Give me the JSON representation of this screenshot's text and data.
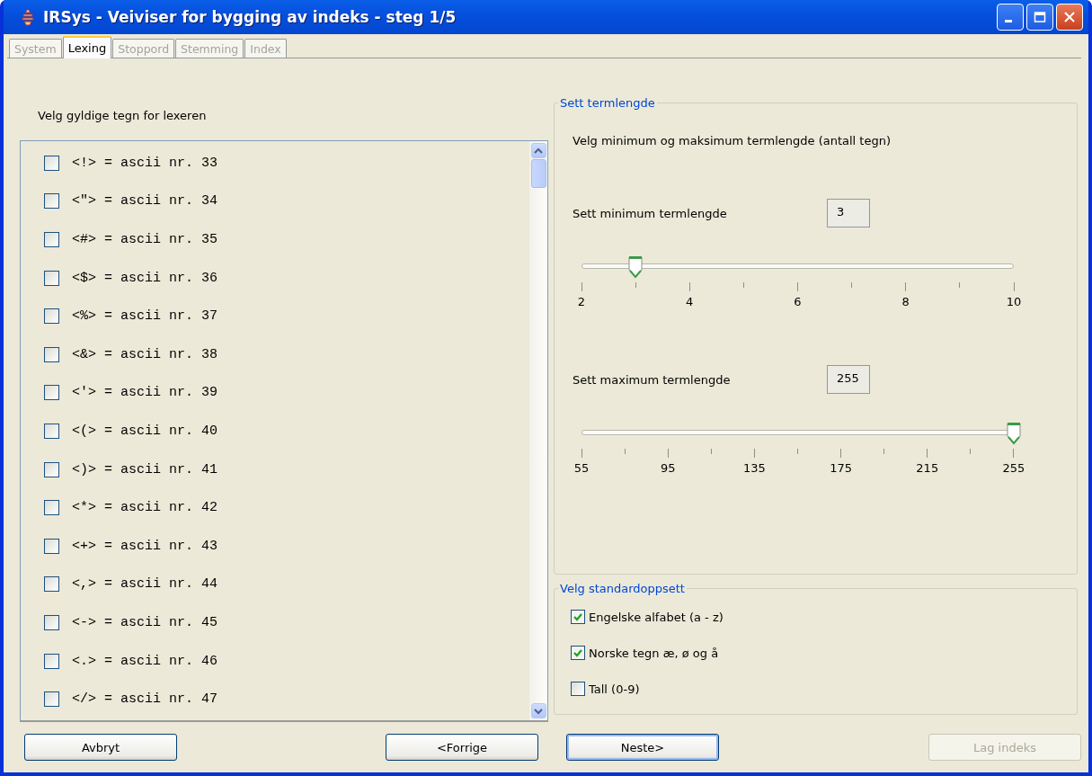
{
  "window": {
    "title": "IRSys - Veiviser for bygging av indeks - steg 1/5"
  },
  "tabs": [
    {
      "label": "System",
      "selected": false,
      "disabled": true
    },
    {
      "label": "Lexing",
      "selected": true,
      "disabled": false
    },
    {
      "label": "Stoppord",
      "selected": false,
      "disabled": true
    },
    {
      "label": "Stemming",
      "selected": false,
      "disabled": true
    },
    {
      "label": "Index",
      "selected": false,
      "disabled": true
    }
  ],
  "left_panel": {
    "heading": "Velg gyldige tegn for lexeren",
    "items": [
      {
        "label": "<!> = ascii nr. 33",
        "checked": false
      },
      {
        "label": "<\"> = ascii nr. 34",
        "checked": false
      },
      {
        "label": "<#> = ascii nr. 35",
        "checked": false
      },
      {
        "label": "<$> = ascii nr. 36",
        "checked": false
      },
      {
        "label": "<%> = ascii nr. 37",
        "checked": false
      },
      {
        "label": "<&> = ascii nr. 38",
        "checked": false
      },
      {
        "label": "<'> = ascii nr. 39",
        "checked": false
      },
      {
        "label": "<(> = ascii nr. 40",
        "checked": false
      },
      {
        "label": "<)> = ascii nr. 41",
        "checked": false
      },
      {
        "label": "<*> = ascii nr. 42",
        "checked": false
      },
      {
        "label": "<+> = ascii nr. 43",
        "checked": false
      },
      {
        "label": "<,> = ascii nr. 44",
        "checked": false
      },
      {
        "label": "<-> = ascii nr. 45",
        "checked": false
      },
      {
        "label": "<.> = ascii nr. 46",
        "checked": false
      },
      {
        "label": "</> = ascii nr. 47",
        "checked": false
      }
    ]
  },
  "term_length": {
    "title": "Sett termlengde",
    "description": "Velg minimum og maksimum termlengde (antall tegn)",
    "sliders": [
      {
        "label": "Sett minimum termlengde",
        "value": "3",
        "level": 0.125,
        "tick_labels": [
          "2",
          "4",
          "6",
          "8",
          "10"
        ]
      },
      {
        "label": "Sett maximum termlengde",
        "value": "255",
        "level": 1,
        "tick_labels": [
          "55",
          "95",
          "135",
          "175",
          "215",
          "255"
        ]
      }
    ]
  },
  "standard_setup": {
    "title": "Velg standardoppsett",
    "options": [
      {
        "label": "Engelske alfabet (a - z)",
        "checked": true
      },
      {
        "label": "Norske tegn æ, ø og å",
        "checked": true
      },
      {
        "label": "Tall (0-9)",
        "checked": false
      }
    ]
  },
  "buttons": [
    {
      "label": "Avbryt",
      "disabled": false,
      "default": false
    },
    {
      "label": "<Forrige",
      "disabled": false,
      "default": false
    },
    {
      "label": "Neste>",
      "disabled": false,
      "default": true
    },
    {
      "label": "Lag indeks",
      "disabled": true,
      "default": false
    }
  ]
}
